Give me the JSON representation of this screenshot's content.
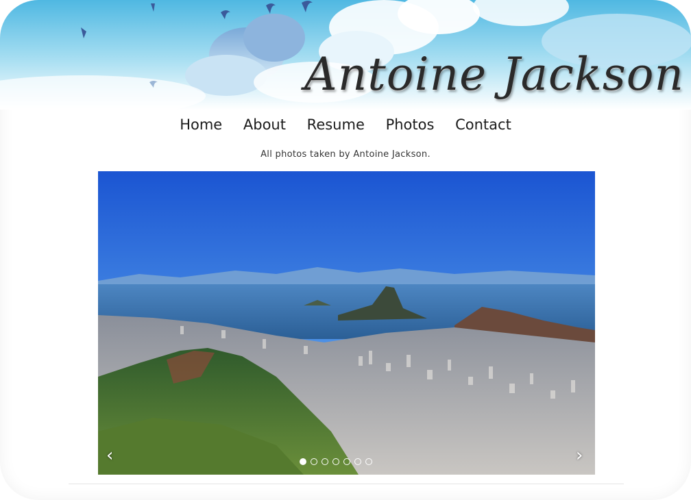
{
  "site": {
    "title": "Antoine Jackson"
  },
  "nav": {
    "items": [
      "Home",
      "About",
      "Resume",
      "Photos",
      "Contact"
    ]
  },
  "caption": "All photos taken by Antoine Jackson.",
  "slideshow": {
    "prev_icon": "‹",
    "next_icon": "›",
    "slide_count": 7,
    "active_slide": 1
  },
  "colors": {
    "sky_top": "#67c3e6",
    "sky_bottom": "#ffffff",
    "photo_sky": "#1f62d8",
    "title_text": "#2a2a2a"
  }
}
